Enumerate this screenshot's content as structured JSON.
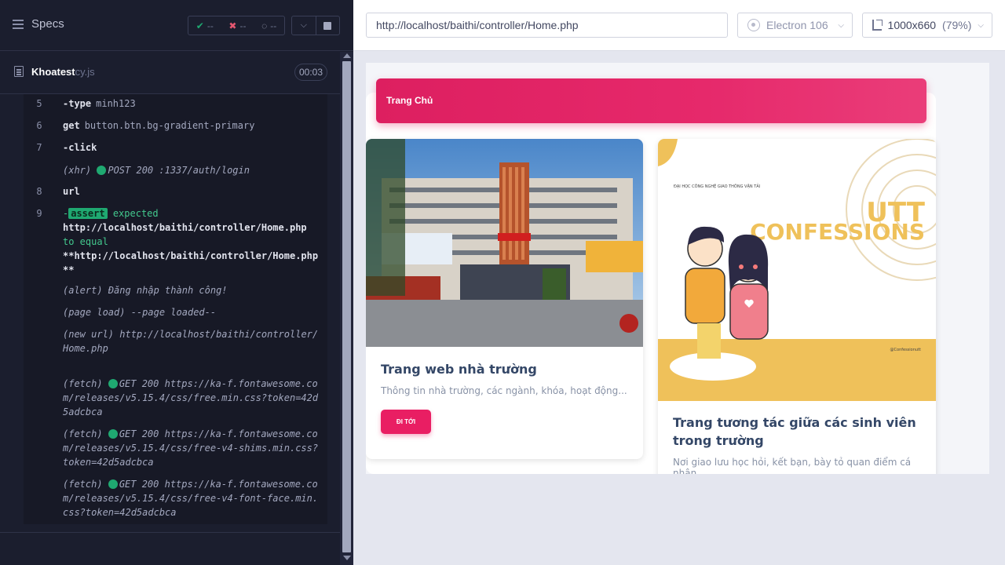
{
  "reporter": {
    "header": {
      "specs_label": "Specs",
      "passed": "--",
      "failed": "--",
      "pending": "--"
    },
    "file": {
      "name": "Khoatest",
      "ext": "cy.js",
      "duration": "00:03"
    },
    "commands": [
      {
        "num": "5",
        "name": "-type",
        "arg": "minh123"
      },
      {
        "num": "6",
        "name": "get",
        "arg": "button.btn.bg-gradient-primary"
      },
      {
        "num": "7",
        "name": "-click",
        "arg": ""
      },
      {
        "num": "",
        "event": "(xhr)",
        "msg": "POST 200 :1337/auth/login"
      },
      {
        "num": "8",
        "name": "url",
        "arg": ""
      },
      {
        "num": "9",
        "name": "-",
        "badge": "assert",
        "expected_label": "expected",
        "expected_value": "http://localhost/baithi/controller/Home.php",
        "to_equal": "to equal",
        "equal_value": "**http://localhost/baithi/controller/Home.php**"
      },
      {
        "num": "",
        "event": "(alert)",
        "msg": "Đăng nhập thành công!"
      },
      {
        "num": "",
        "event": "(page load)",
        "msg": "--page loaded--"
      },
      {
        "num": "",
        "event": "(new url)",
        "msg": "http://localhost/baithi/controller/Home.php"
      },
      {
        "num": "",
        "event": "(fetch)",
        "msg": "GET 200 https://ka-f.fontawesome.com/releases/v5.15.4/css/free.min.css?token=42d5adcbca"
      },
      {
        "num": "",
        "event": "(fetch)",
        "msg": "GET 200 https://ka-f.fontawesome.com/releases/v5.15.4/css/free-v4-shims.min.css?token=42d5adcbca"
      },
      {
        "num": "",
        "event": "(fetch)",
        "msg": "GET 200 https://ka-f.fontawesome.com/releases/v5.15.4/css/free-v4-font-face.min.css?token=42d5adcbca"
      }
    ]
  },
  "aut": {
    "url": "http://localhost/baithi/controller/Home.php",
    "browser": "Electron 106",
    "viewport": "1000x660",
    "viewport_pct": "(79%)",
    "app": {
      "nav_title": "Trang Chủ",
      "cards": [
        {
          "image_icon": "school-building-photo",
          "title": "Trang web nhà trường",
          "desc": "Thông tin nhà trường, các ngành, khóa, hoạt động...",
          "button": "ĐI TỚI"
        },
        {
          "image_icon": "utt-confessions-poster",
          "poster_heading": "ĐẠI HỌC CÔNG NGHỆ GIAO THÔNG VẬN TẢI",
          "poster_title_1": "UTT",
          "poster_title_2": "CONFESSIONS",
          "poster_contact": "@Confessionutt",
          "title": "Trang tương tác giữa các sinh viên trong trường",
          "desc": "Nơi giao lưu học hỏi, kết bạn, bày tỏ quan điểm cá nhân..."
        }
      ]
    }
  },
  "colors": {
    "passed": "#1fa971",
    "failed": "#e45770",
    "primary": "#e91e63"
  }
}
